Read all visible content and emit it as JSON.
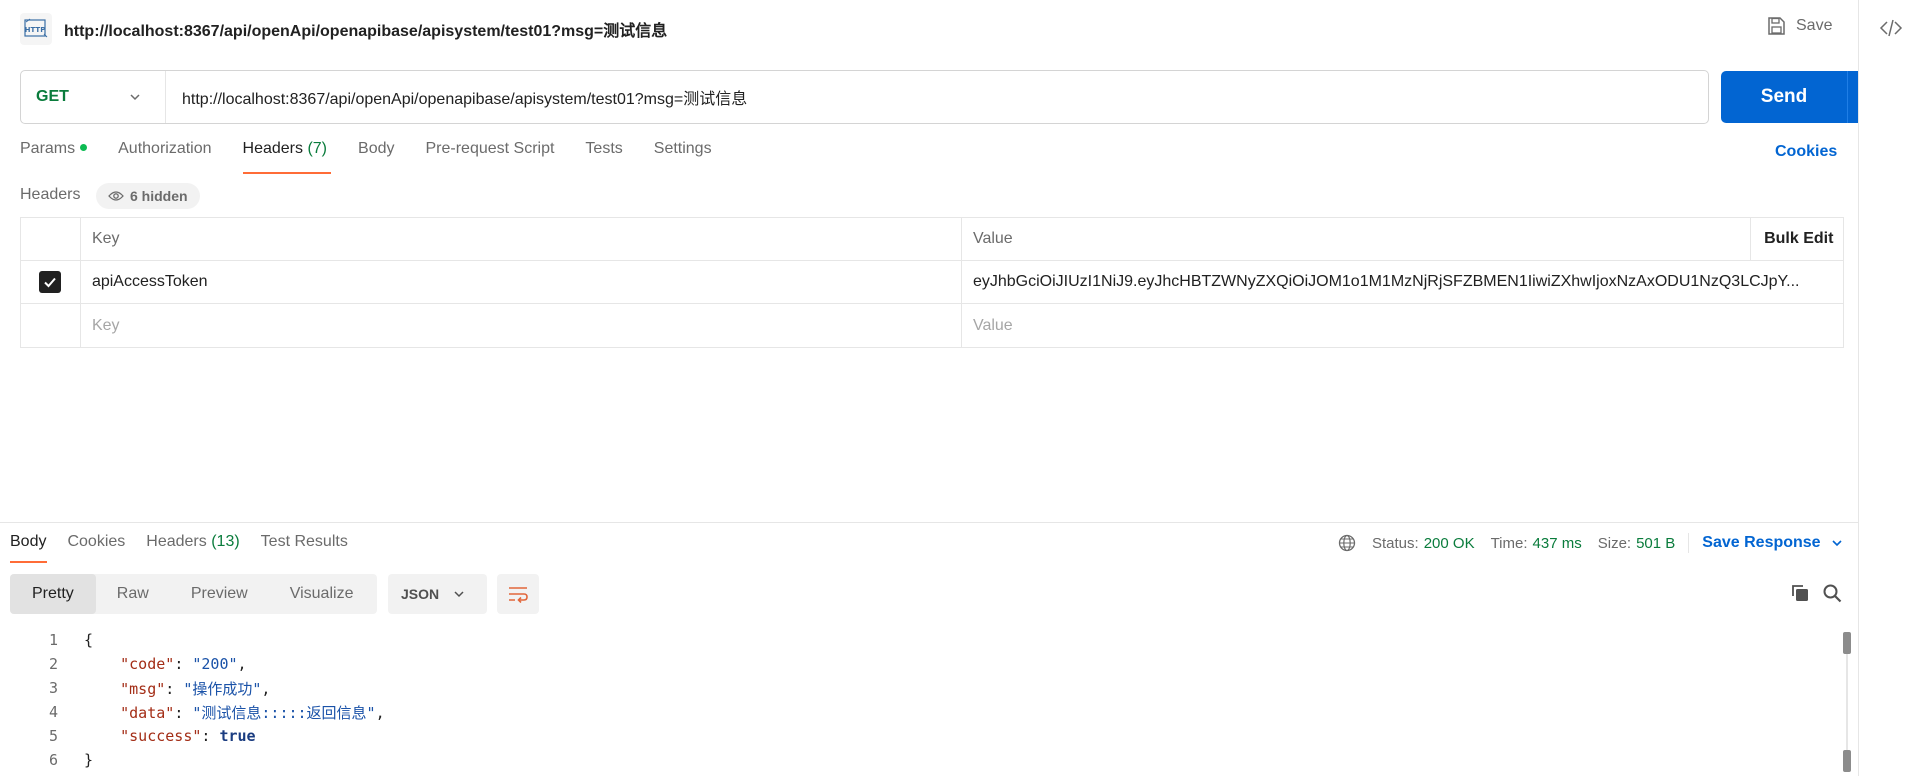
{
  "request": {
    "title": "http://localhost:8367/api/openApi/openapibase/apisystem/test01?msg=测试信息",
    "save_label": "Save",
    "method": "GET",
    "url": "http://localhost:8367/api/openApi/openapibase/apisystem/test01?msg=测试信息",
    "send_label": "Send"
  },
  "tabs": {
    "params": "Params",
    "authorization": "Authorization",
    "headers": "Headers",
    "headers_count": "(7)",
    "body": "Body",
    "prerequest": "Pre-request Script",
    "tests": "Tests",
    "settings": "Settings",
    "cookies": "Cookies"
  },
  "headers_section": {
    "label": "Headers",
    "hidden": "6 hidden",
    "columns": {
      "key": "Key",
      "value": "Value",
      "bulk_edit": "Bulk Edit"
    },
    "rows": [
      {
        "key": "apiAccessToken",
        "value": "eyJhbGciOiJIUzI1NiJ9.eyJhcHBTZWNyZXQiOiJOM1o1M1MzNjRjSFZBMEN1IiwiZXhwIjoxNzAxODU1NzQ3LCJpY..."
      }
    ],
    "placeholder": {
      "key": "Key",
      "value": "Value"
    }
  },
  "response": {
    "tabs": {
      "body": "Body",
      "cookies": "Cookies",
      "headers": "Headers",
      "headers_count": "(13)",
      "test_results": "Test Results"
    },
    "status_label": "Status:",
    "status_value": "200 OK",
    "time_label": "Time:",
    "time_value": "437 ms",
    "size_label": "Size:",
    "size_value": "501 B",
    "save_response": "Save Response",
    "views": [
      "Pretty",
      "Raw",
      "Preview",
      "Visualize"
    ],
    "format": "JSON"
  },
  "code_lines": [
    {
      "n": "1",
      "parts": [
        [
          "p",
          "{"
        ]
      ]
    },
    {
      "n": "2",
      "parts": [
        [
          "p",
          "    "
        ],
        [
          "k",
          "\"code\""
        ],
        [
          "p",
          ": "
        ],
        [
          "s",
          "\"200\""
        ],
        [
          "p",
          ","
        ]
      ]
    },
    {
      "n": "3",
      "parts": [
        [
          "p",
          "    "
        ],
        [
          "k",
          "\"msg\""
        ],
        [
          "p",
          ": "
        ],
        [
          "s",
          "\"操作成功\""
        ],
        [
          "p",
          ","
        ]
      ]
    },
    {
      "n": "4",
      "parts": [
        [
          "p",
          "    "
        ],
        [
          "k",
          "\"data\""
        ],
        [
          "p",
          ": "
        ],
        [
          "s",
          "\"测试信息:::::返回信息\""
        ],
        [
          "p",
          ","
        ]
      ]
    },
    {
      "n": "5",
      "parts": [
        [
          "p",
          "    "
        ],
        [
          "k",
          "\"success\""
        ],
        [
          "p",
          ": "
        ],
        [
          "b",
          "true"
        ]
      ]
    },
    {
      "n": "6",
      "parts": [
        [
          "p",
          "}"
        ]
      ]
    }
  ]
}
